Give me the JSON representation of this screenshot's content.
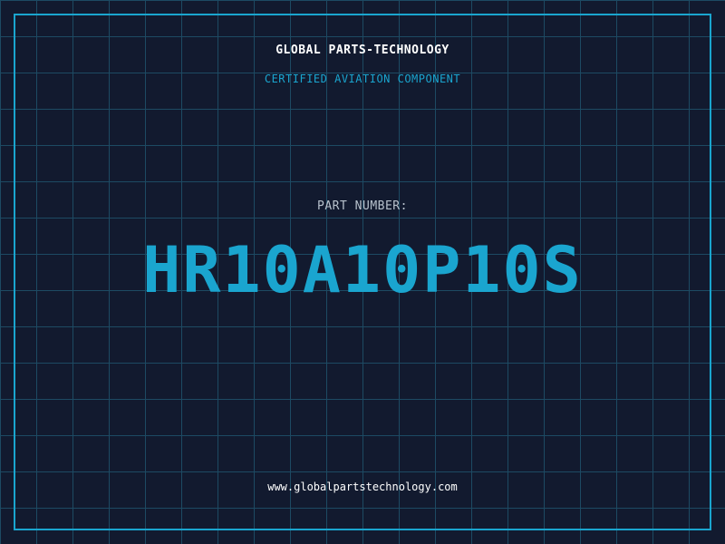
{
  "header": {
    "company": "GLOBAL PARTS-TECHNOLOGY",
    "tagline": "CERTIFIED AVIATION COMPONENT"
  },
  "part": {
    "label": "PART NUMBER:",
    "number": "HR10A10P10S"
  },
  "footer": {
    "website": "www.globalpartstechnology.com"
  },
  "colors": {
    "background": "#121a2f",
    "grid": "#1d4a63",
    "accent": "#1aa5cf",
    "text": "#ffffff",
    "muted": "#b7c1cc"
  }
}
